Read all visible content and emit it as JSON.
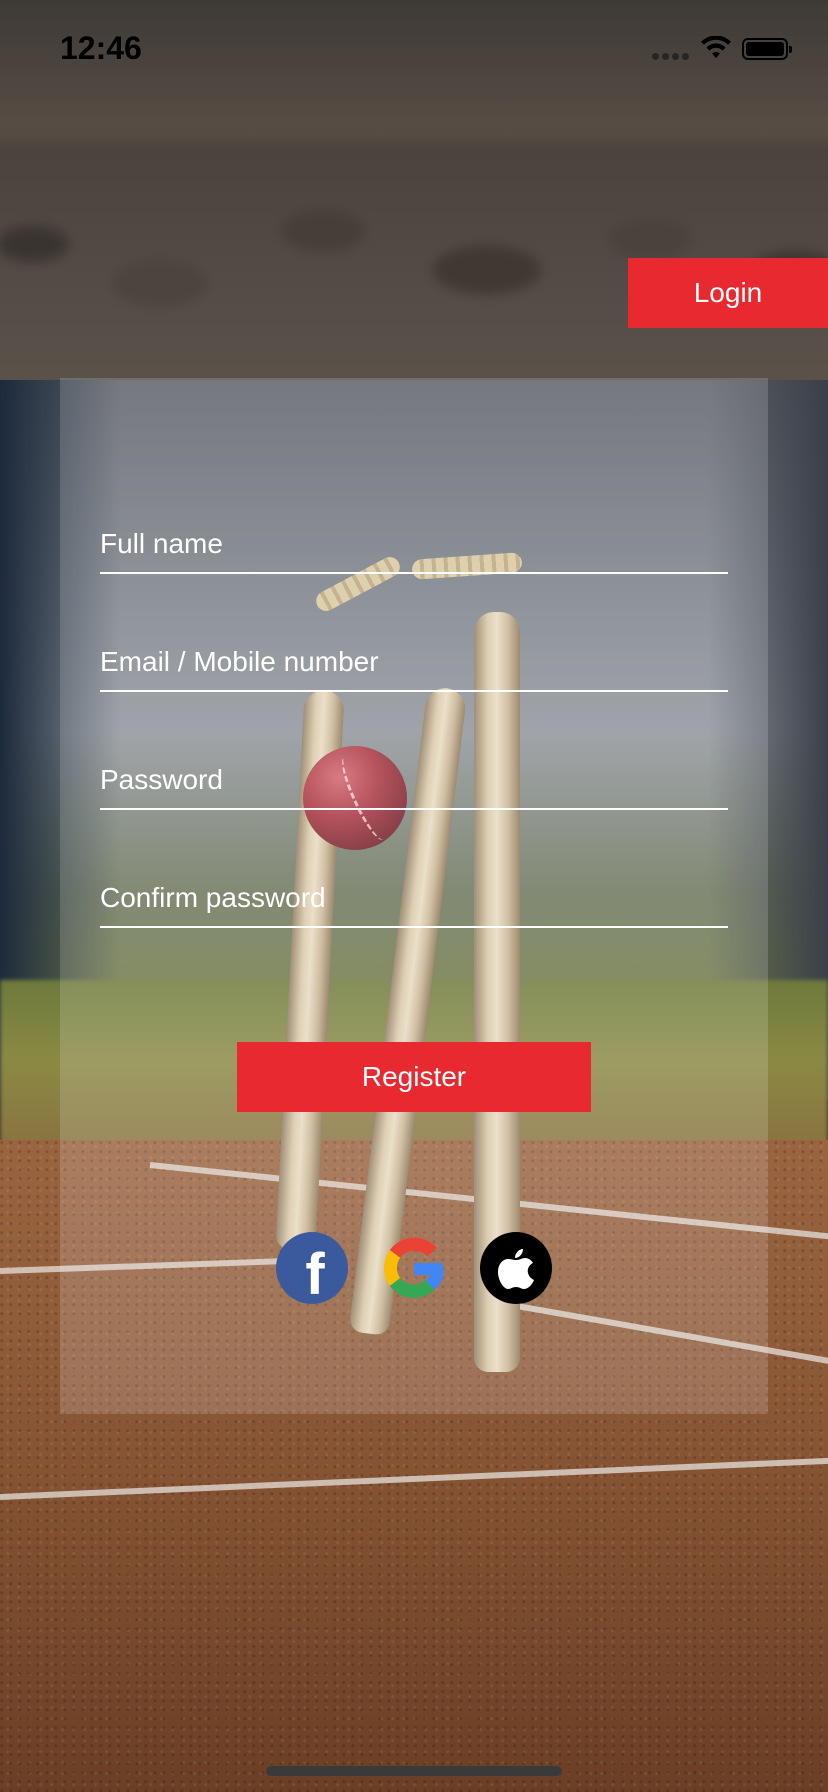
{
  "status_bar": {
    "time": "12:46"
  },
  "header": {
    "login_label": "Login"
  },
  "form": {
    "full_name_placeholder": "Full name",
    "full_name_value": "",
    "email_placeholder": "Email / Mobile number",
    "email_value": "",
    "password_placeholder": "Password",
    "password_value": "",
    "confirm_password_placeholder": "Confirm password",
    "confirm_password_value": "",
    "register_label": "Register"
  },
  "social": {
    "facebook_glyph": "f",
    "items": [
      "facebook-icon",
      "google-icon",
      "apple-icon"
    ]
  },
  "colors": {
    "accent": "#e8292f",
    "facebook": "#3b5a9e",
    "apple": "#000000"
  }
}
